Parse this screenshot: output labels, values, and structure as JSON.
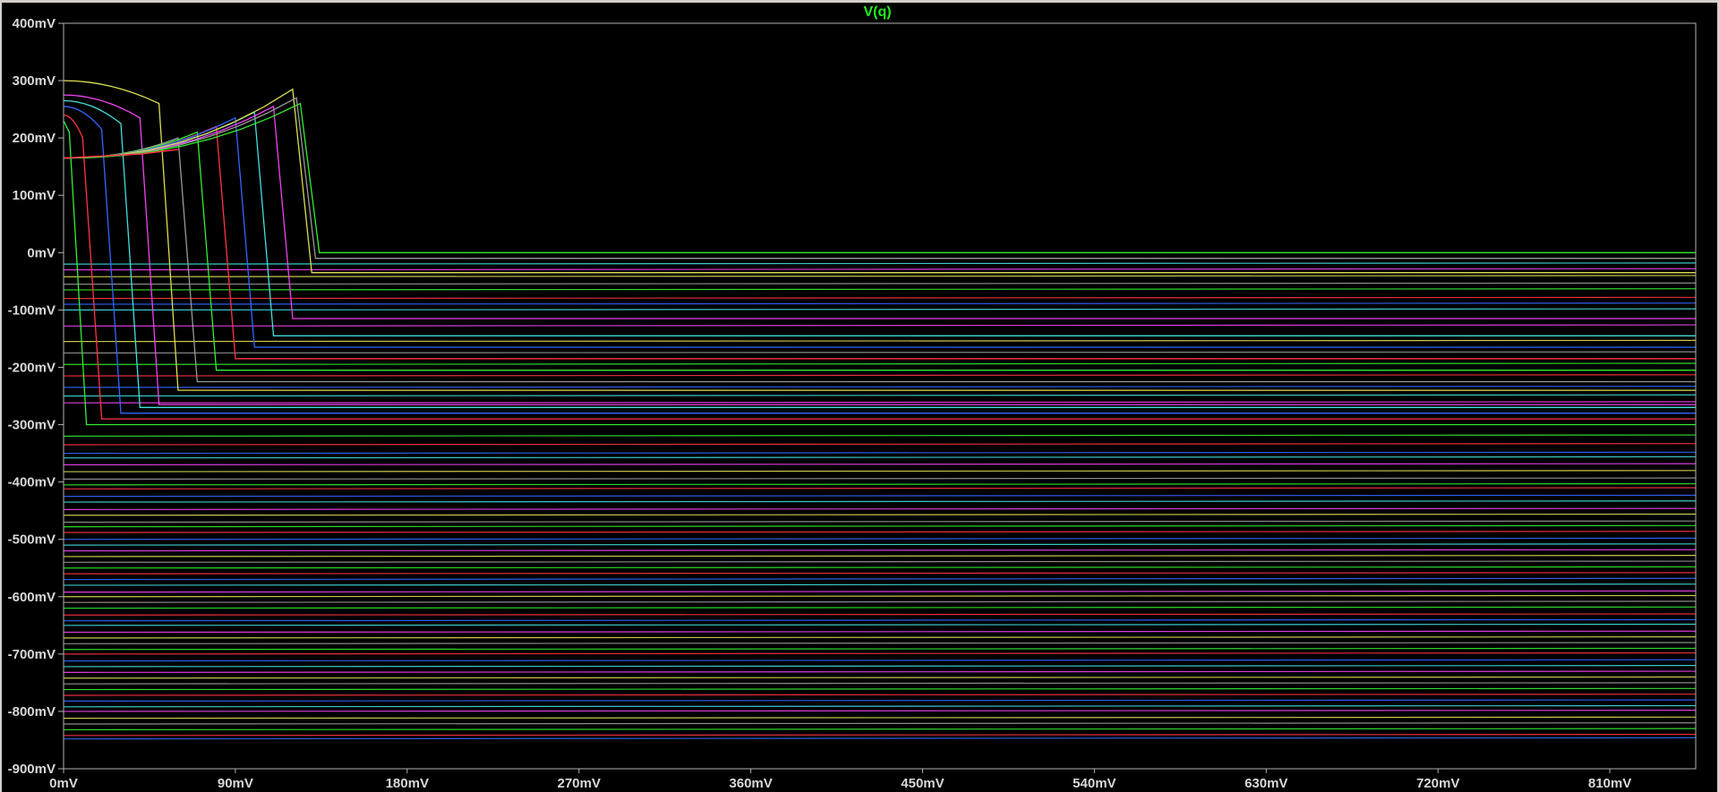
{
  "chart_data": {
    "type": "line",
    "title": "V(q)",
    "title_color": "#22ee22",
    "xlabel": "",
    "ylabel": "",
    "x_unit": "mV",
    "y_unit": "mV",
    "xlim": [
      0,
      855
    ],
    "ylim": [
      -900,
      400
    ],
    "x_ticks": [
      0,
      90,
      180,
      270,
      360,
      450,
      540,
      630,
      720,
      810
    ],
    "x_tick_labels": [
      "0mV",
      "90mV",
      "180mV",
      "270mV",
      "360mV",
      "450mV",
      "540mV",
      "630mV",
      "720mV",
      "810mV"
    ],
    "y_ticks": [
      400,
      300,
      200,
      100,
      0,
      -100,
      -200,
      -300,
      -400,
      -500,
      -600,
      -700,
      -800,
      -900
    ],
    "y_tick_labels": [
      "400mV",
      "300mV",
      "200mV",
      "100mV",
      "0mV",
      "-100mV",
      "-200mV",
      "-300mV",
      "-400mV",
      "-500mV",
      "-600mV",
      "-700mV",
      "-800mV",
      "-900mV"
    ],
    "grid": false,
    "legend": "none",
    "background": "#000000",
    "axis_color": "#b0b0b0",
    "series_colors": [
      "#33ee33",
      "#ff3344",
      "#3366ff",
      "#44dddd",
      "#ee44ee",
      "#dddd55",
      "#999999"
    ],
    "family": {
      "count": 84,
      "description_source": "parameter sweep of V(q), each trace transitions from a high level to a flat low level",
      "switching_traces": [
        {
          "x_switch": 0,
          "y_start": 230,
          "y_final": -300
        },
        {
          "x_switch": 10,
          "y_start": 240,
          "y_final": -290
        },
        {
          "x_switch": 20,
          "y_start": 255,
          "y_final": -280
        },
        {
          "x_switch": 30,
          "y_start": 265,
          "y_final": -270
        },
        {
          "x_switch": 40,
          "y_start": 275,
          "y_final": -265
        },
        {
          "x_switch": 50,
          "y_start": 300,
          "y_final": -240
        },
        {
          "x_switch": 60,
          "y_start": 200,
          "y_final": -225
        },
        {
          "x_switch": 70,
          "y_start": 210,
          "y_final": -205
        },
        {
          "x_switch": 80,
          "y_start": 220,
          "y_final": -185
        },
        {
          "x_switch": 90,
          "y_start": 235,
          "y_final": -165
        },
        {
          "x_switch": 100,
          "y_start": 245,
          "y_final": -145
        },
        {
          "x_switch": 110,
          "y_start": 255,
          "y_final": -115
        },
        {
          "x_switch": 120,
          "y_start": 285,
          "y_final": -35
        },
        {
          "x_switch": 122,
          "y_start": 270,
          "y_final": -10
        },
        {
          "x_switch": 124,
          "y_start": 260,
          "y_final": 0
        }
      ],
      "flat_levels_below": [
        -320,
        -335,
        -350,
        -358,
        -370,
        -382,
        -395,
        -405,
        -412,
        -425,
        -435,
        -448,
        -458,
        -470,
        -478,
        -488,
        -500,
        -510,
        -520,
        -530,
        -540,
        -550,
        -560,
        -570,
        -580,
        -592,
        -600,
        -610,
        -620,
        -632,
        -642,
        -650,
        -662,
        -672,
        -682,
        -692,
        -700,
        -712,
        -722,
        -732,
        -742,
        -752,
        -762,
        -772,
        -782,
        -792,
        -800,
        -812,
        -822,
        -832,
        -842,
        -848
      ],
      "extra_flat_levels": [
        -20,
        -30,
        -42,
        -55,
        -65,
        -80,
        -90,
        -100,
        -128,
        -155,
        -175,
        -195,
        -215,
        -235,
        -250,
        -262
      ]
    }
  }
}
